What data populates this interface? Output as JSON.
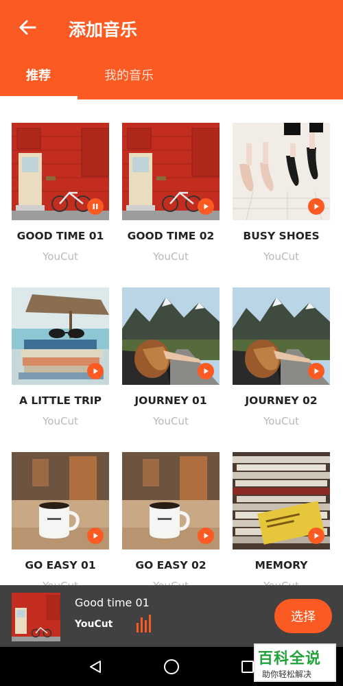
{
  "header": {
    "title": "添加音乐",
    "tabs": [
      {
        "label": "推荐",
        "active": true
      },
      {
        "label": "我的音乐",
        "active": false
      }
    ],
    "accent_color": "#fb5a22"
  },
  "songs": [
    {
      "title": "GOOD TIME 01",
      "artist": "YouCut",
      "state": "playing",
      "thumb": "red-wall-door-bicycle"
    },
    {
      "title": "GOOD TIME 02",
      "artist": "YouCut",
      "state": "paused",
      "thumb": "red-wall-door-bicycle"
    },
    {
      "title": "BUSY SHOES",
      "artist": "YouCut",
      "state": "paused",
      "thumb": "ballet-shoes"
    },
    {
      "title": "A LITTLE TRIP",
      "artist": "YouCut",
      "state": "paused",
      "thumb": "beach-books-sunglasses"
    },
    {
      "title": "JOURNEY 01",
      "artist": "YouCut",
      "state": "paused",
      "thumb": "car-window-mountains"
    },
    {
      "title": "JOURNEY 02",
      "artist": "YouCut",
      "state": "paused",
      "thumb": "car-window-mountains"
    },
    {
      "title": "GO EASY 01",
      "artist": "YouCut",
      "state": "paused",
      "thumb": "coffee-mug-table"
    },
    {
      "title": "GO EASY 02",
      "artist": "YouCut",
      "state": "paused",
      "thumb": "coffee-mug-table"
    },
    {
      "title": "MEMORY",
      "artist": "YouCut",
      "state": "paused",
      "thumb": "stacked-books"
    }
  ],
  "player": {
    "title": "Good time 01",
    "artist": "YouCut",
    "select_label": "选择",
    "icon": "equalizer-icon"
  },
  "navbar": {
    "icons": [
      "back-triangle-icon",
      "home-circle-icon",
      "recents-square-icon"
    ]
  },
  "watermark": {
    "main": "百科全说",
    "sub": "助你轻松解决"
  }
}
